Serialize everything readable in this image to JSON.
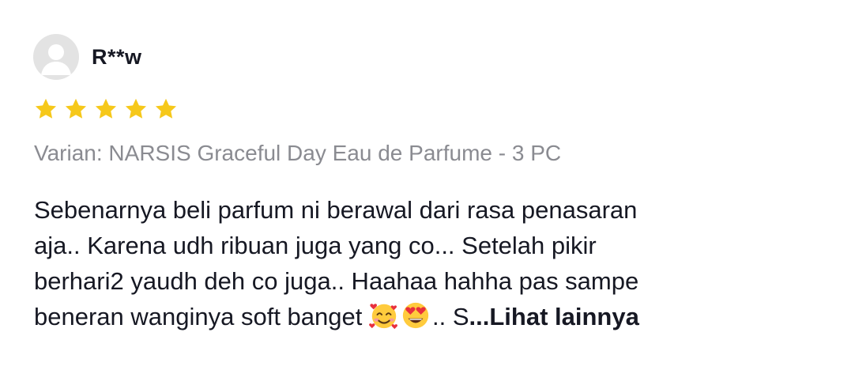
{
  "review": {
    "username": "R**w",
    "rating": 5,
    "rating_max": 5,
    "star_color": "#f6c81a",
    "variant": "Varian: NARSIS Graceful Day Eau de Parfume - 3 PC",
    "text_lines": [
      "Sebenarnya beli parfum ni berawal dari rasa penasaran",
      "aja.. Karena udh ribuan juga yang co... Setelah pikir",
      "berhari2 yaudh deh co juga.. Haahaa hahha pas sampe",
      "beneran wanginya soft banget "
    ],
    "emojis": [
      "smiling-face-with-hearts-icon",
      "heart-eyes-face-icon"
    ],
    "text_tail": ".. S",
    "see_more_label": "...Lihat lainnya"
  }
}
